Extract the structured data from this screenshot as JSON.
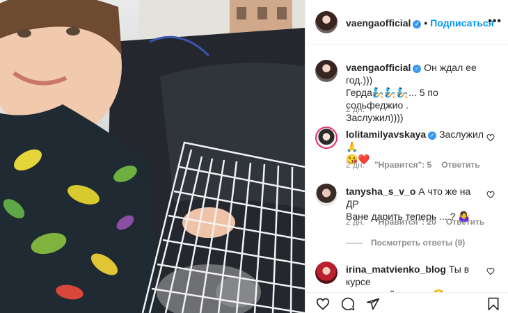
{
  "post": {
    "username": "vaengaofficial",
    "follow_label": "Подписаться",
    "more_label": "•••",
    "caption_line1": "Он ждал ее год.)))",
    "caption_line2": "Герда🧞🧞🧞... 5 по сольфеджио .",
    "caption_line3": "Заслужил))))",
    "time": "2 дн."
  },
  "comments": [
    {
      "username": "lolitamilyavskaya",
      "text_line1": "Заслужил🙏",
      "text_line2": "😘❤️",
      "time": "2 дн.",
      "likes": "\"Нравится\": 5",
      "reply_label": "Ответить"
    },
    {
      "username": "tanysha_s_v_o",
      "text_line1": "А что же на ДР",
      "text_line2": "Ване дарить теперь ....? 🤷‍♀️",
      "time": "2 дн.",
      "likes": "\"Нравится\": 20",
      "reply_label": "Ответить"
    },
    {
      "username": "irina_matvienko_blog",
      "text_line1": "Ты в курсе",
      "text_line2": "это ночной житель 😂он спать"
    }
  ],
  "replies_label": "Посмотреть ответы (9)",
  "colors": {
    "accent": "#0095f6",
    "verified": "#3897f0",
    "muted": "#8e8e8e",
    "text": "#262626"
  },
  "icons": [
    "heart-icon",
    "comment-icon",
    "share-icon",
    "bookmark-icon",
    "more-icon",
    "verified-icon"
  ]
}
